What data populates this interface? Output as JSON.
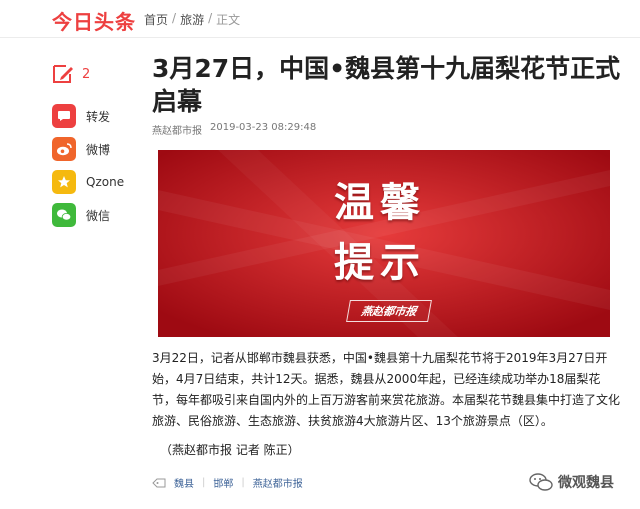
{
  "header": {
    "logo": "今日头条",
    "breadcrumb": [
      "首页",
      "旅游",
      "正文"
    ],
    "separator": "/"
  },
  "sidebar": {
    "comment_count": "2",
    "share": [
      {
        "label": "转发",
        "icon": "repost-icon",
        "color": "#ed4040"
      },
      {
        "label": "微博",
        "icon": "weibo-icon",
        "color": "#f0652b"
      },
      {
        "label": "Qzone",
        "icon": "qzone-star-icon",
        "color": "#f5b90f"
      },
      {
        "label": "微信",
        "icon": "wechat-icon",
        "color": "#3fb93b"
      }
    ]
  },
  "article": {
    "title": "3月27日，中国•魏县第十九届梨花节正式启幕",
    "source": "燕赵都市报",
    "time": "2019-03-23 08:29:48",
    "image": {
      "line1": "温馨",
      "line2": "提示",
      "stamp": "燕赵都市报"
    },
    "body": "3月22日，记者从邯郸市魏县获悉，中国•魏县第十九届梨花节将于2019年3月27日开始，4月7日结束，共计12天。据悉，魏县从2000年起，已经连续成功举办18届梨花节，每年都吸引来自国内外的上百万游客前来赏花旅游。本届梨花节魏县集中打造了文化旅游、民俗旅游、生态旅游、扶贫旅游4大旅游片区、13个旅游景点（区）。",
    "byline": "（燕赵都市报 记者 陈正）",
    "tags": [
      "魏县",
      "邯郸",
      "燕赵都市报"
    ]
  },
  "watermark": "微观魏县",
  "colors": {
    "brand_red": "#ed4040",
    "tag_link": "#406599",
    "hero_red": "#c8101a"
  }
}
